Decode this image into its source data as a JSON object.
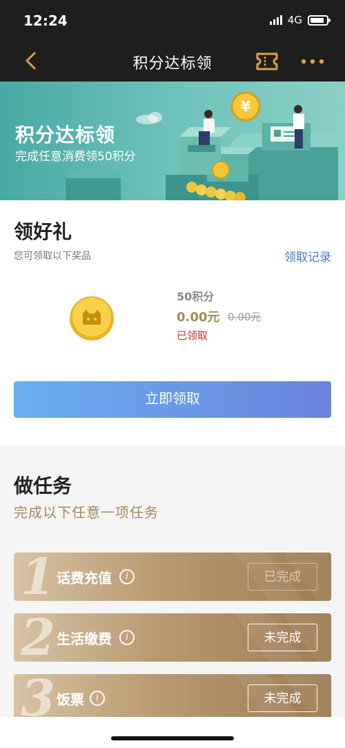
{
  "status_bar": {
    "time": "12:24",
    "network": "4G"
  },
  "nav": {
    "title": "积分达标领"
  },
  "banner": {
    "title": "积分达标领",
    "subtitle": "完成任意消费领50积分"
  },
  "gift": {
    "heading": "领好礼",
    "subtitle": "您可领取以下奖品",
    "record_link": "领取记录",
    "prize": {
      "name": "50积分",
      "price": "0.00元",
      "original_price": "0.00元",
      "status": "已领取"
    },
    "claim_button": "立即领取"
  },
  "tasks": {
    "heading": "做任务",
    "subtitle": "完成以下任意一项任务",
    "items": [
      {
        "number": "1",
        "label": "话费充值",
        "info": "i",
        "status": "已完成"
      },
      {
        "number": "2",
        "label": "生活缴费",
        "info": "i",
        "status": "未完成"
      },
      {
        "number": "3",
        "label": "饭票",
        "info": "i",
        "status": "未完成"
      }
    ]
  },
  "colors": {
    "accent_blue": "#4677c9",
    "gold": "#a08a55",
    "claimed_red": "#c4332b",
    "button_start": "#6aaef0",
    "button_end": "#6b83de"
  }
}
